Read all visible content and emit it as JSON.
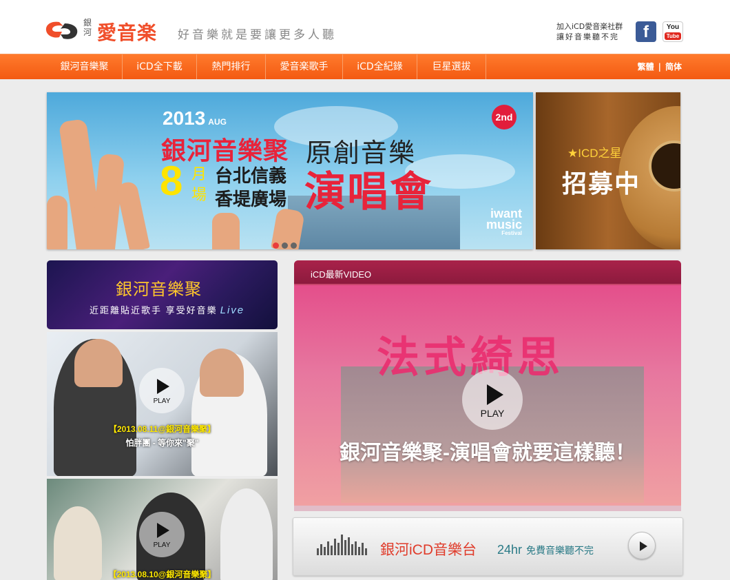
{
  "header": {
    "logo_small": "銀河",
    "logo_text": "愛音楽",
    "slogan": "好音樂就是要讓更多人聽",
    "community_line1": "加入iCD愛音楽社群",
    "community_line2": "讓好音樂聽不完",
    "facebook_icon": "facebook-icon",
    "youtube_icon": "youtube-icon",
    "youtube_you": "You",
    "youtube_tube": "Tube"
  },
  "nav": {
    "items": [
      {
        "label": "銀河音樂聚"
      },
      {
        "label": "iCD全下載"
      },
      {
        "label": "熱門排行"
      },
      {
        "label": "愛音楽歌手"
      },
      {
        "label": "iCD全紀錄"
      },
      {
        "label": "巨星選拔"
      }
    ],
    "lang_traditional": "繁體",
    "lang_separator": "|",
    "lang_simplified": "简体"
  },
  "hero": {
    "year": "2013",
    "month_tag": "AUG",
    "title_red": "銀河音樂聚",
    "title_black": "原創音樂",
    "number": "8",
    "yue_chang": "月場",
    "place_line1": "台北信義",
    "place_line2": "香堤廣場",
    "concert": "演唱會",
    "badge": "2nd",
    "festival_brand": "iwant music",
    "festival_sub": "Festival"
  },
  "side_banner": {
    "star_text": "ICD之星",
    "recruit_text": "招募中"
  },
  "galaxy_banner": {
    "title": "銀河音樂聚",
    "subtitle": "近距離貼近歌手 享受好音樂",
    "live": "Live"
  },
  "videos_left": [
    {
      "play_label": "PLAY",
      "date": "【2013.08.11@銀河音樂聚】",
      "title": "怕胖團 - 等你來\"聚\""
    },
    {
      "play_label": "PLAY",
      "date": "【2013.08.10@銀河音樂聚】"
    }
  ],
  "video_panel": {
    "header": "iCD最新VIDEO",
    "big_title": "法式綺思",
    "play_label": "PLAY",
    "slogan": "銀河音樂聚-演唱會就要這樣聽！"
  },
  "radio": {
    "title": "銀河iCD音樂台",
    "hours": "24hr",
    "subtitle": "免費音樂聽不完"
  },
  "colors": {
    "brand_orange": "#f35a12",
    "logo_red": "#f04e2a",
    "accent_pink": "#e44f8b"
  }
}
